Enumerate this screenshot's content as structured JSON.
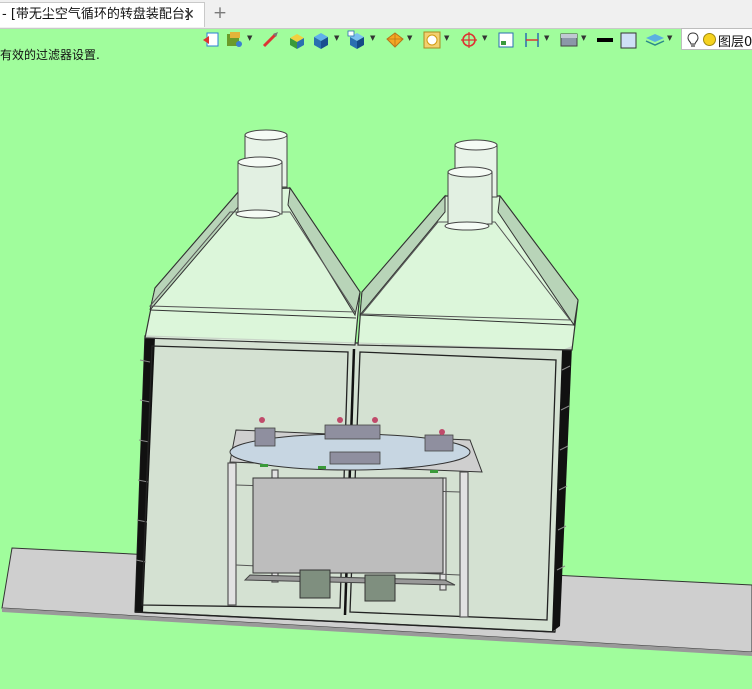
{
  "tab": {
    "title": "- [带无尘空气循环的转盘装配台]",
    "close": "✕",
    "add": "+"
  },
  "hint_text": "有效的过滤器设置.",
  "layer_label": "图层0",
  "colors": {
    "viewport": "#a0fd9c",
    "tabbar": "#f0f0f0",
    "cabinet_frame": "#101010",
    "cabinet_glass": "#d7e6d5",
    "hood_glass": "#e6f5e5",
    "floor_plate": "#cfcfcf"
  },
  "toolbar_icons": [
    "view-back-icon",
    "material-icon",
    "measure-icon",
    "box-render-icon",
    "solid-render-icon",
    "view-cube-icon",
    "appearance-icon",
    "sphere-render-icon",
    "target-icon",
    "frame-icon",
    "dimension-icon",
    "surface-icon",
    "line-color-icon",
    "fill-color-icon",
    "layers-icon",
    "lightbulb-icon",
    "layer-color-icon"
  ],
  "scene": {
    "name": "带无尘空气循环的转盘装配台 3D model"
  }
}
